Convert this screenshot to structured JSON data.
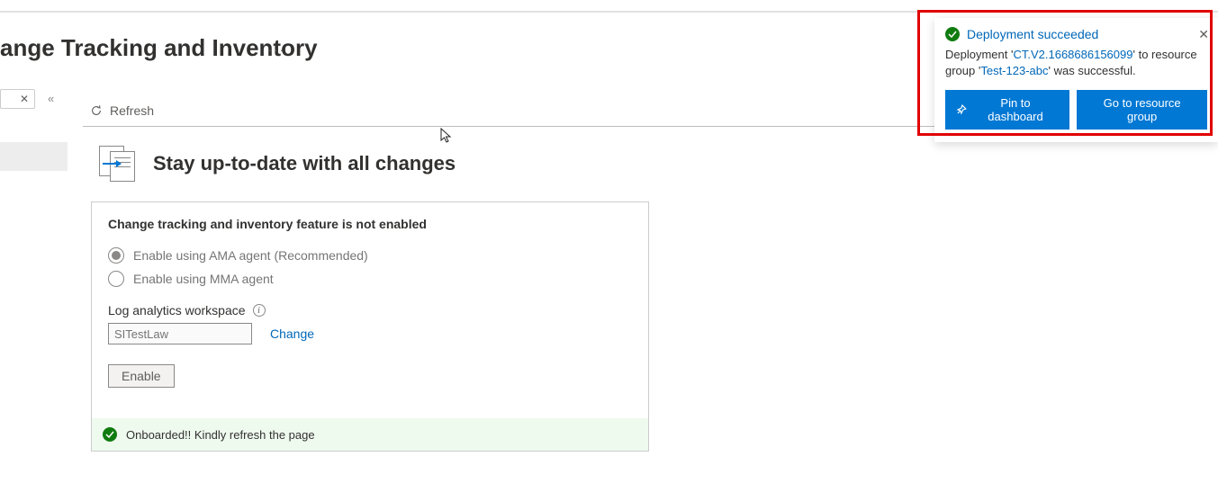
{
  "page": {
    "title_visible": "ange Tracking and Inventory",
    "ellipsis": "···"
  },
  "toolbar": {
    "refresh_label": "Refresh"
  },
  "hero": {
    "heading": "Stay up-to-date with all changes"
  },
  "card": {
    "heading": "Change tracking and inventory feature is not enabled",
    "option_ama": "Enable using AMA agent (Recommended)",
    "option_mma": "Enable using MMA agent",
    "law_label": "Log analytics workspace",
    "law_value": "SITestLaw",
    "change_link": "Change",
    "enable_btn": "Enable",
    "onboarded_msg": "Onboarded!! Kindly refresh the page"
  },
  "notification": {
    "title": "Deployment succeeded",
    "body_prefix": "Deployment '",
    "deployment_link": "CT.V2.1668686156099",
    "body_mid": "' to resource group '",
    "rg_link": "Test-123-abc",
    "body_suffix": "' was successful.",
    "pin_btn": "Pin to dashboard",
    "goto_btn": "Go to resource group"
  }
}
